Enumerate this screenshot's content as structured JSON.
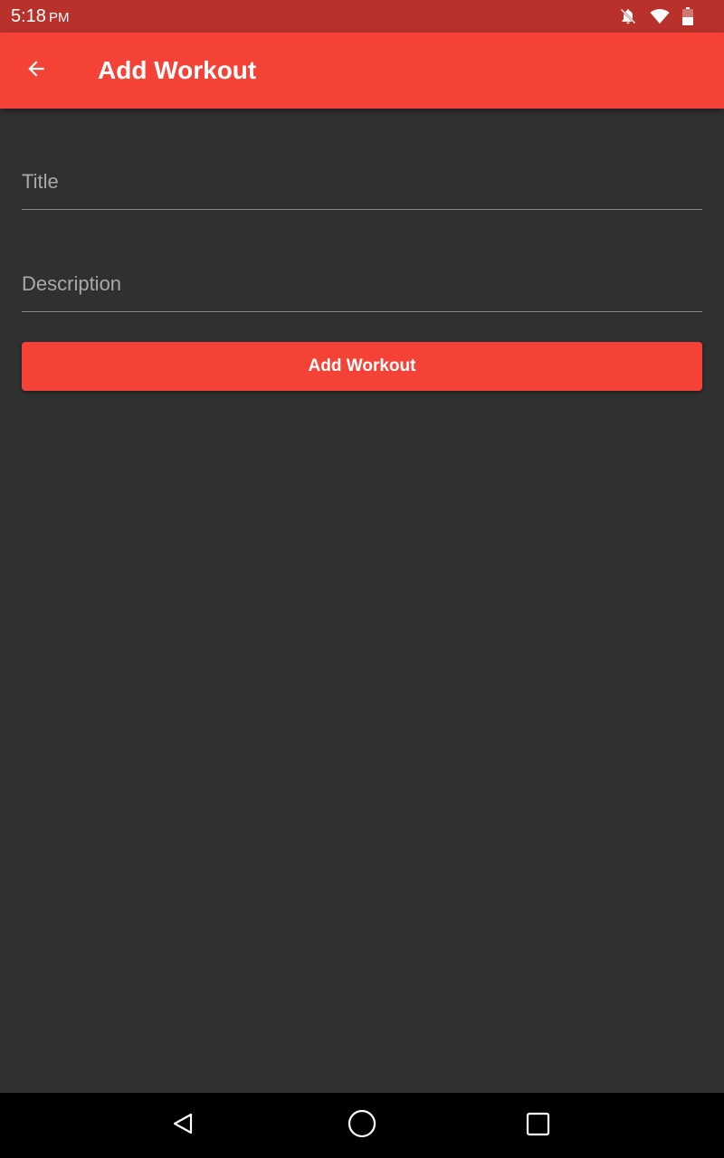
{
  "status_bar": {
    "time": "5:18",
    "ampm": "PM",
    "icons": [
      "notifications-off-icon",
      "wifi-icon",
      "battery-icon"
    ]
  },
  "app_bar": {
    "title": "Add Workout",
    "back_icon": "arrow-back-icon"
  },
  "form": {
    "title_field": {
      "placeholder": "Title",
      "value": ""
    },
    "description_field": {
      "placeholder": "Description",
      "value": ""
    },
    "submit_label": "Add Workout"
  },
  "nav_bar": {
    "icons": [
      "nav-back-icon",
      "nav-home-icon",
      "nav-recents-icon"
    ]
  },
  "colors": {
    "accent": "#f44336",
    "status_bar": "#b8312a",
    "background": "#303030"
  }
}
